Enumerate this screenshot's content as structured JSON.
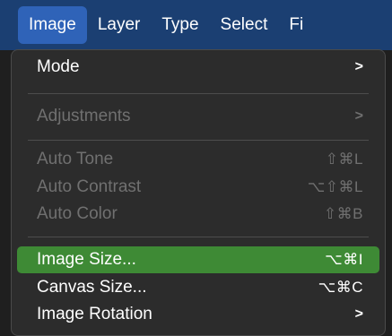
{
  "menubar": {
    "items": [
      {
        "label": "Image"
      },
      {
        "label": "Layer"
      },
      {
        "label": "Type"
      },
      {
        "label": "Select"
      },
      {
        "label": "Fi"
      }
    ]
  },
  "menu": {
    "mode": {
      "label": "Mode",
      "chevron": ">"
    },
    "adjustments": {
      "label": "Adjustments",
      "chevron": ">"
    },
    "auto_tone": {
      "label": "Auto Tone",
      "shortcut": "⇧⌘L"
    },
    "auto_contrast": {
      "label": "Auto Contrast",
      "shortcut": "⌥⇧⌘L"
    },
    "auto_color": {
      "label": "Auto Color",
      "shortcut": "⇧⌘B"
    },
    "image_size": {
      "label": "Image Size...",
      "shortcut": "⌥⌘I"
    },
    "canvas_size": {
      "label": "Canvas Size...",
      "shortcut": "⌥⌘C"
    },
    "image_rotation": {
      "label": "Image Rotation",
      "chevron": ">"
    }
  },
  "colors": {
    "menubar_bg": "#1b3f72",
    "active_menu": "#2f63b8",
    "dropdown_bg": "#2c2c2c",
    "highlight": "#3e8a35",
    "disabled_text": "#707070"
  }
}
